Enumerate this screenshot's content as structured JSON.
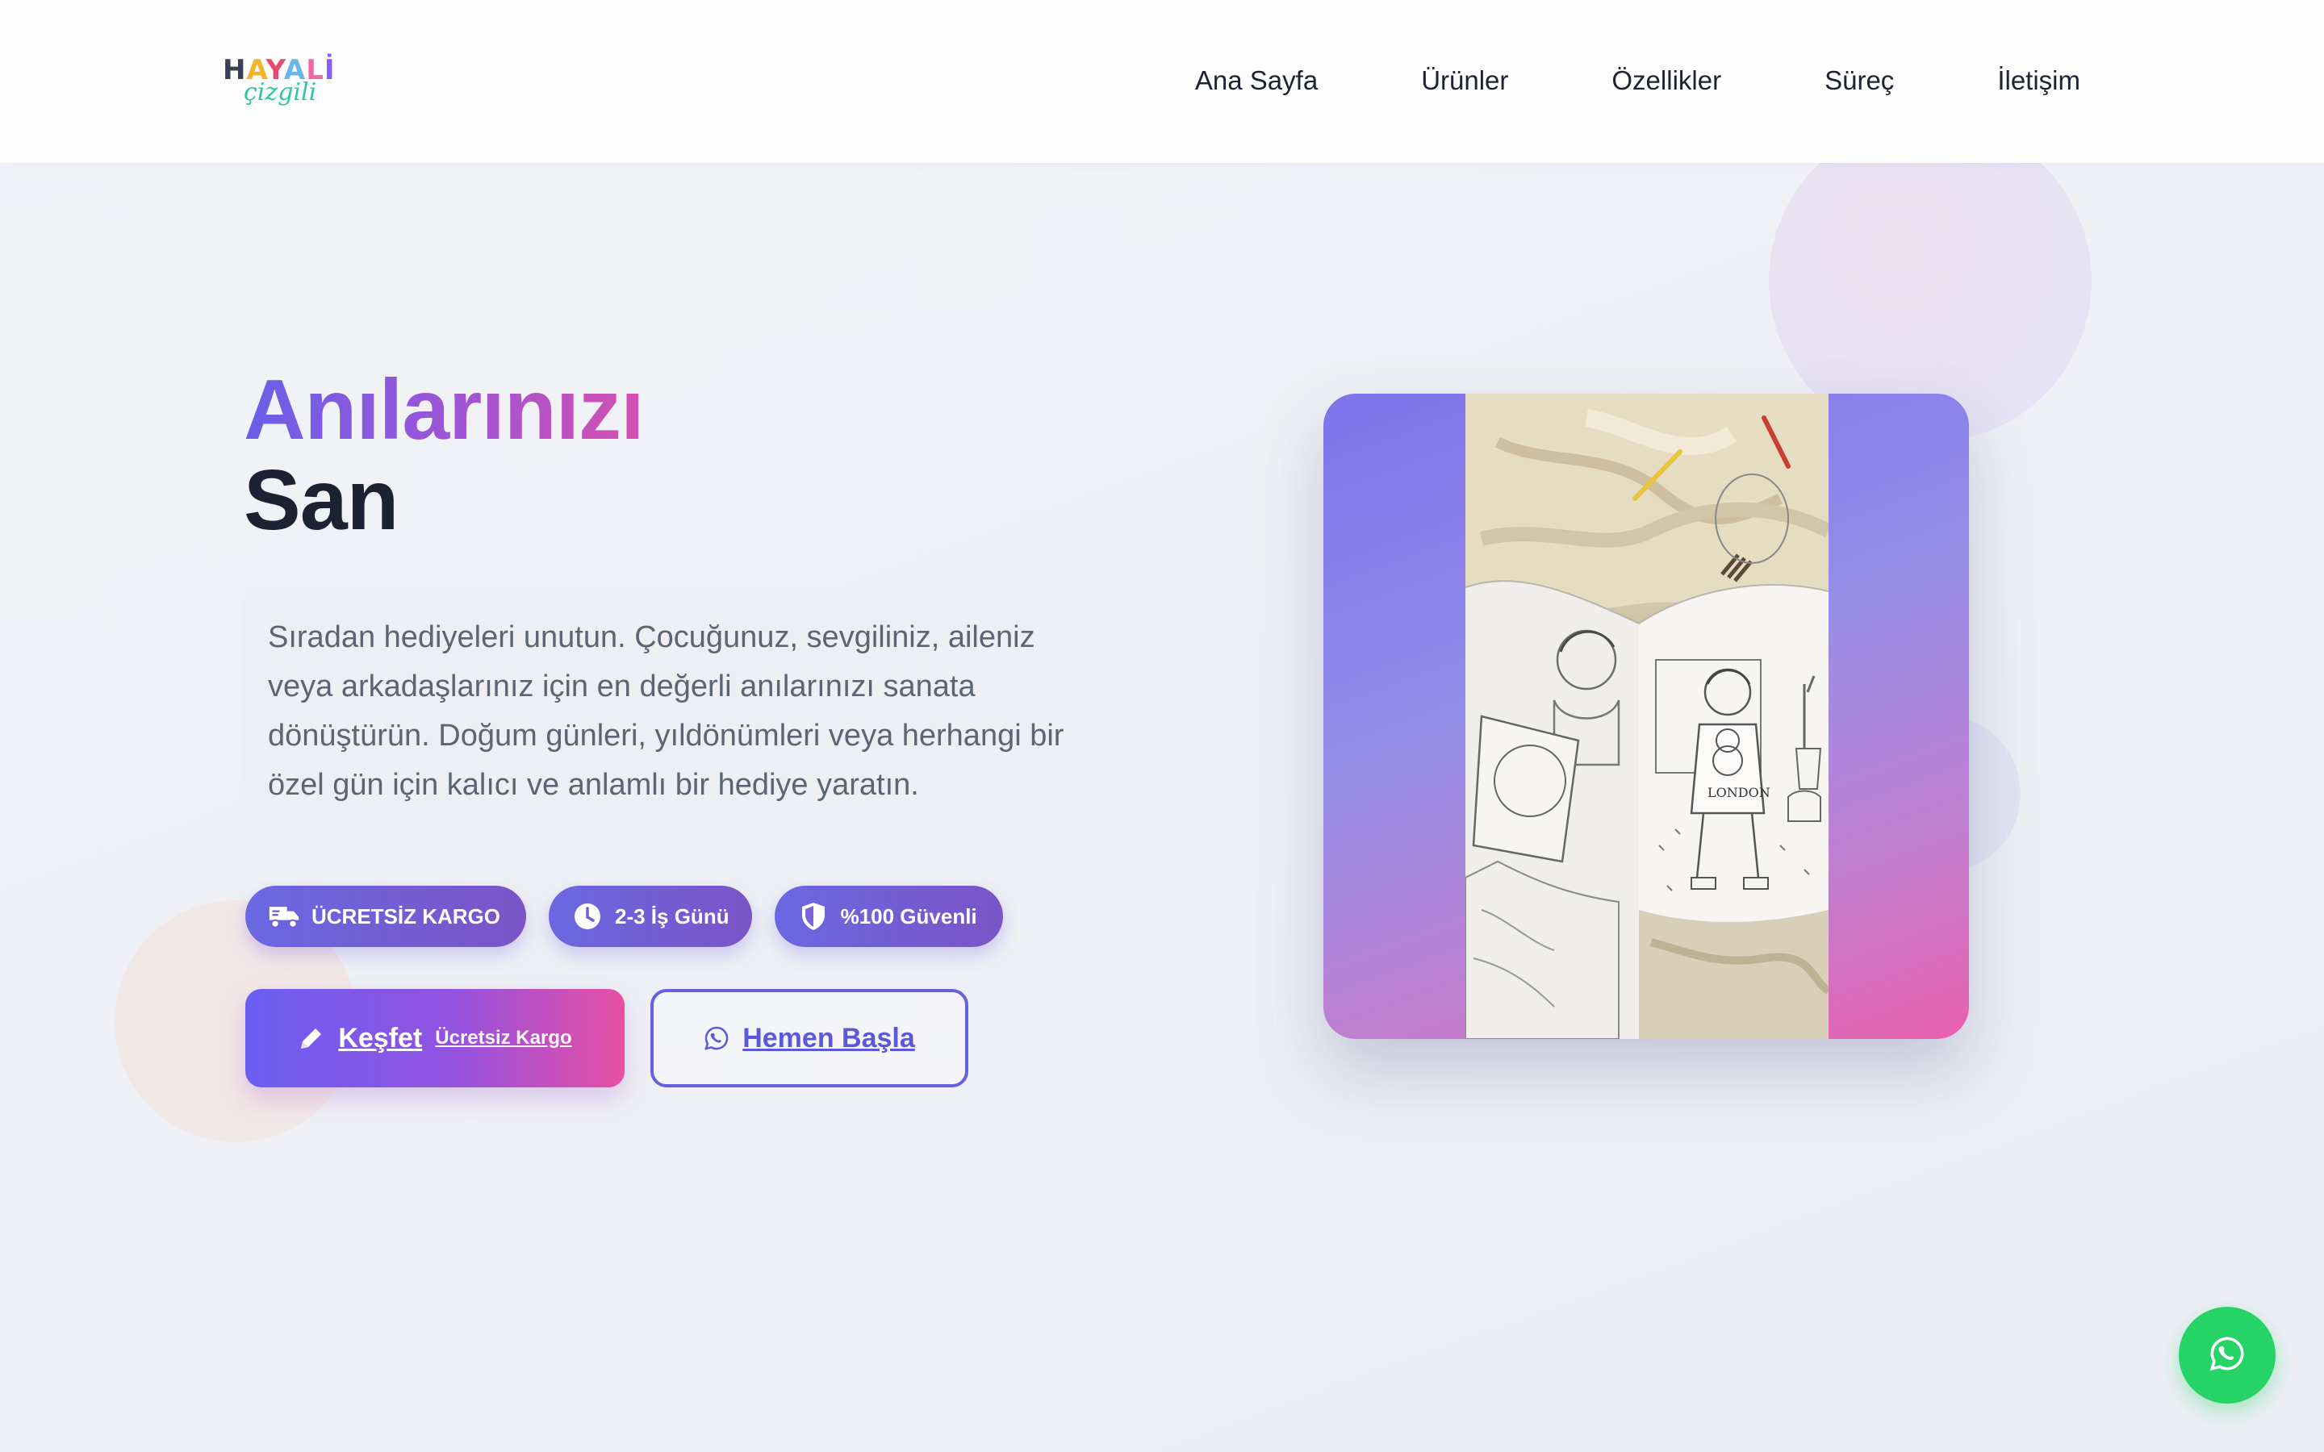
{
  "brand": {
    "logo_top": [
      "H",
      "A",
      "Y",
      "A",
      "L",
      "İ"
    ],
    "logo_bottom": "çizgili"
  },
  "nav": {
    "items": [
      {
        "label": "Ana Sayfa"
      },
      {
        "label": "Ürünler"
      },
      {
        "label": "Özellikler"
      },
      {
        "label": "Süreç"
      },
      {
        "label": "İletişim"
      }
    ]
  },
  "hero": {
    "title_line_1": "Anılarınızı",
    "title_line_2": "San",
    "description": "Sıradan hediyeleri unutun. Çocuğunuz, sevgiliniz, aileniz veya arkadaşlarınız için en değerli anılarınızı sanata dönüştürün. Doğum günleri, yıldönümleri veya herhangi bir özel gün için kalıcı ve anlamlı bir hediye yaratın.",
    "badges": [
      {
        "label": "ÜCRETSİZ KARGO",
        "icon": "truck-icon"
      },
      {
        "label": "2-3 İş Günü",
        "icon": "clock-icon"
      },
      {
        "label": "%100 Güvenli",
        "icon": "shield-icon"
      }
    ],
    "primary_button": {
      "label": "Keşfet",
      "sub_label": "Ücretsiz Kargo",
      "icon": "pencil-icon"
    },
    "secondary_button": {
      "label": "Hemen Başla",
      "icon": "whatsapp-icon"
    },
    "image": {
      "page_text": "LONDON"
    }
  },
  "floating": {
    "icon": "whatsapp-icon"
  },
  "colors": {
    "accent": "#6a5ef1",
    "accent_pink": "#e84fa2",
    "whatsapp": "#25d366",
    "text_dark": "#1c2233"
  }
}
